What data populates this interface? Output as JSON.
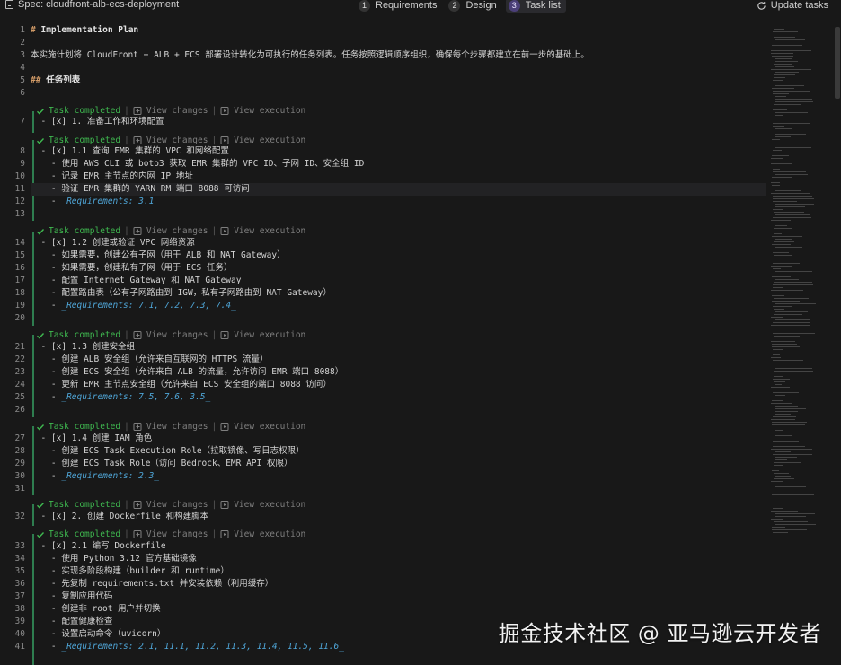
{
  "header": {
    "spec_title": "Spec: cloudfront-alb-ecs-deployment",
    "steps": [
      {
        "num": "1",
        "label": "Requirements"
      },
      {
        "num": "2",
        "label": "Design"
      },
      {
        "num": "3",
        "label": "Task list"
      }
    ],
    "update_label": "Update tasks"
  },
  "codelens": {
    "status": "Task completed",
    "view_changes": "View changes",
    "view_execution": "View execution"
  },
  "lines": {
    "l1": "Implementation Plan",
    "l3": "本实施计划将 CloudFront + ALB + ECS 部署设计转化为可执行的任务列表。任务按照逻辑顺序组织，确保每个步骤都建立在前一步的基础上。",
    "l5": "任务列表",
    "l7": "1. 准备工作和环境配置",
    "l8": "1.1 查询 EMR 集群的 VPC 和网络配置",
    "l9": "使用 AWS CLI 或 boto3 获取 EMR 集群的 VPC ID、子网 ID、安全组 ID",
    "l10": "记录 EMR 主节点的内网 IP 地址",
    "l11": "验证 EMR 集群的 YARN RM 端口 8088 可访问",
    "l12": "_Requirements: 3.1_",
    "l14": "1.2 创建或验证 VPC 网络资源",
    "l15": "如果需要，创建公有子网（用于 ALB 和 NAT Gateway）",
    "l16": "如果需要，创建私有子网（用于 ECS 任务）",
    "l17": "配置 Internet Gateway 和 NAT Gateway",
    "l18": "配置路由表（公有子网路由到 IGW，私有子网路由到 NAT Gateway）",
    "l19": "_Requirements: 7.1, 7.2, 7.3, 7.4_",
    "l21": "1.3 创建安全组",
    "l22": "创建 ALB 安全组（允许来自互联网的 HTTPS 流量）",
    "l23": "创建 ECS 安全组（允许来自 ALB 的流量，允许访问 EMR 端口 8088）",
    "l24": "更新 EMR 主节点安全组（允许来自 ECS 安全组的端口 8088 访问）",
    "l25": "_Requirements: 7.5, 7.6, 3.5_",
    "l27": "1.4 创建 IAM 角色",
    "l28": "创建 ECS Task Execution Role（拉取镜像、写日志权限）",
    "l29": "创建 ECS Task Role（访问 Bedrock、EMR API 权限）",
    "l30": "_Requirements: 2.3_",
    "l32": "2. 创建 Dockerfile 和构建脚本",
    "l33": "2.1 编写 Dockerfile",
    "l34": "使用 Python 3.12 官方基础镜像",
    "l35": "实现多阶段构建（builder 和 runtime）",
    "l36": "先复制 requirements.txt 并安装依赖（利用缓存）",
    "l37": "复制应用代码",
    "l38": "创建非 root 用户并切换",
    "l39": "配置健康检查",
    "l40": "设置启动命令（uvicorn）",
    "l41": "_Requirements: 2.1, 11.1, 11.2, 11.3, 11.4, 11.5, 11.6_"
  },
  "line_numbers": [
    "1",
    "2",
    "3",
    "4",
    "5",
    "7",
    "8",
    "9",
    "10",
    "11",
    "12",
    "13",
    "14",
    "15",
    "16",
    "17",
    "18",
    "19",
    "20",
    "21",
    "22",
    "23",
    "24",
    "25",
    "26",
    "27",
    "28",
    "29",
    "30",
    "31",
    "32",
    "33",
    "34",
    "35",
    "36",
    "37",
    "38",
    "39",
    "40",
    "41"
  ],
  "watermark": "掘金技术社区 @ 亚马逊云开发者",
  "colors": {
    "background": "#181818",
    "task_completed": "#3fb950",
    "requirements_link": "#4fa6d8",
    "heading_hash": "#d19a66",
    "active_step_badge": "#4b3f78"
  }
}
